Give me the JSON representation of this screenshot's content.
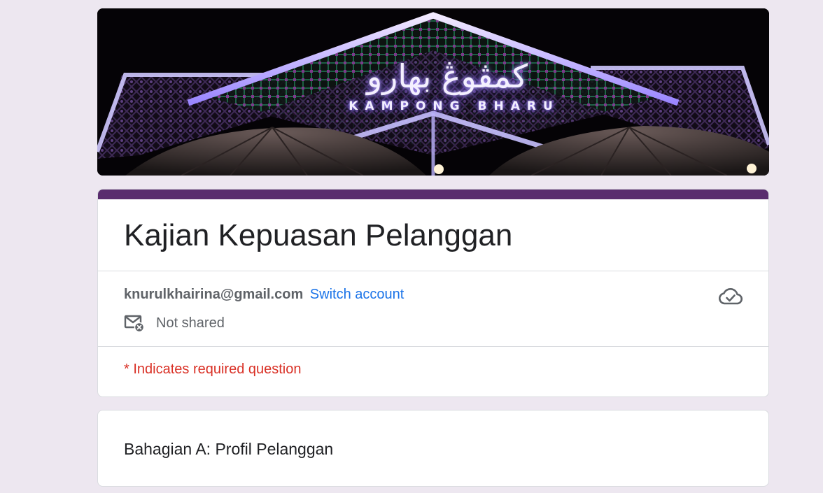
{
  "banner": {
    "sign_jawi": "كمڤوڠ بهارو",
    "sign_latin": "KAMPONG BHARU"
  },
  "form": {
    "title": "Kajian Kepuasan Pelanggan",
    "accent_color": "#5a2d6e",
    "account_email": "knurulkhairina@gmail.com",
    "switch_account_label": "Switch account",
    "share_status": "Not shared",
    "required_note": "* Indicates required question",
    "save_status_icon": "cloud-done-icon",
    "share_status_icon": "mail-off-icon"
  },
  "sections": [
    {
      "title": "Bahagian A: Profil Pelanggan"
    }
  ],
  "colors": {
    "background": "#ede7f0",
    "link": "#1a73e8",
    "required": "#d93025"
  }
}
